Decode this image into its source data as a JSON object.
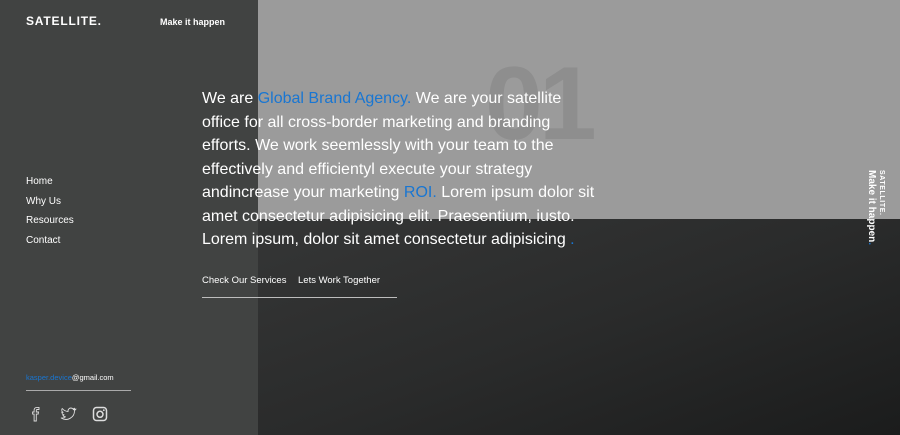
{
  "header": {
    "logo": "SATELLITE.",
    "tagline": "Make it happen"
  },
  "big_number": "01",
  "nav": {
    "items": [
      "Home",
      "Why Us",
      "Resources",
      "Contact"
    ]
  },
  "hero": {
    "part1": "We are ",
    "highlight1": "Global Brand Agency.",
    "part2": " We are your satellite office for all cross-border marketing and branding efforts. We work seemlessly with your team to the effectively and efficientyl execute your strategy andincrease your marketing ",
    "highlight2": "ROI.",
    "part3": " Lorem ipsum dolor sit amet consectetur adipisicing elit. Praesentium, iusto. Lorem ipsum, dolor sit amet consectetur adipisicing ",
    "highlight3": "."
  },
  "cta": {
    "services": "Check Our Services",
    "work": "Lets Work Together"
  },
  "footer": {
    "email_user": "kasper.device",
    "email_domain": "@gmail.com"
  },
  "socials": [
    "facebook-icon",
    "twitter-icon",
    "instagram-icon"
  ],
  "vertical": {
    "logo": "SATELLITE.",
    "tagline": "Make it happen",
    "tagline_dot": "."
  },
  "colors": {
    "accent": "#1976d2",
    "sidebar": "#414342",
    "panel": "#9b9b9b"
  }
}
